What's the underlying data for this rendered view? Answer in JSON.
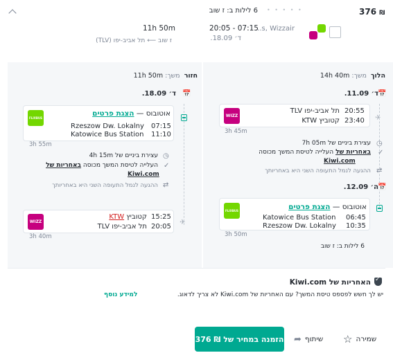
{
  "header": {
    "price": "376",
    "currency_symbol": "₪",
    "nights": "6 לילות ב: ז שוב",
    "carriers_text": "...s, Wizzair",
    "outbound_time": "20:05 - 07:15",
    "outbound_duration": "11h 50m",
    "outbound_date": "ד׳ 18.09.",
    "route_to": "ז שוב",
    "route_from": "תל אביב-יפו (TLV)"
  },
  "outbound": {
    "direction_label": "הלוך",
    "duration_label": "משך:",
    "duration": "14h 40m",
    "date": "ד׳ 11.09.",
    "flight": {
      "dep_time": "20:55",
      "dep_place": "תל אביב-יפו TLV",
      "arr_time": "23:40",
      "arr_place": "קטוביץ KTW",
      "duration": "3h 45m",
      "logo_text": "WIZZ"
    },
    "layover": {
      "title": "עצירת ביניים של 7h 05m",
      "self_transfer": "העלייה לטיסת המשך מכוסה",
      "guarantee_link": "באחריות של",
      "kiwi": "Kiwi.com",
      "terminal_note": "ההגעה לנמל התעופה השני היא באחריותך"
    },
    "date2": "ה׳ 12.09.",
    "bus": {
      "title_link": "הצגת פרטים",
      "title_prefix": "אוטובוס —",
      "dep_time": "06:45",
      "dep_place": "Katowice Bus Station",
      "arr_time": "10:35",
      "arr_place": "Rzeszow Dw. Lokalny",
      "duration": "3h 50m",
      "logo_text": "FLIXBUS"
    },
    "nights_note": "6 לילות ב: ז שוב"
  },
  "return": {
    "direction_label": "חזור",
    "duration_label": "משך:",
    "duration": "11h 50m",
    "date": "ד׳ 18.09.",
    "bus": {
      "title_link": "הצגת פרטים",
      "title_prefix": "אוטובוס —",
      "dep_time": "07:15",
      "dep_place": "Rzeszow Dw. Lokalny",
      "arr_time": "11:10",
      "arr_place": "Katowice Bus Station",
      "duration": "3h 55m",
      "logo_text": "FLIXBUS"
    },
    "layover": {
      "title": "עצירת ביניים של 4h 15m",
      "self_transfer": "העלייה לטיסת המשך מכוסה",
      "guarantee_link": "באחריות של",
      "kiwi": "Kiwi.com",
      "terminal_note": "ההגעה לנמל התעופה השני היא באחריותך"
    },
    "flight": {
      "dep_time": "15:25",
      "dep_place_prefix": "קטוביץ",
      "dep_code": "KTW",
      "arr_time": "20:05",
      "arr_place": "תל אביב-יפו TLV",
      "duration": "3h 40m",
      "logo_text": "WIZZ"
    }
  },
  "guarantee": {
    "title": "האחריות של Kiwi.com",
    "body": "יש לך חשש לפספס טיסת המשך? עם האחריות של Kiwi.com לא צריך לדאוג.",
    "more_link": "למידע נוסף"
  },
  "footer": {
    "save_label": "שמירה",
    "share_label": "שיתוף",
    "book_label": "הזמנה במחיר של",
    "book_price": "₪ 376"
  },
  "colors": {
    "accent": "#00a991",
    "flixbus": "#73d700",
    "wizzair": "#c6007e"
  }
}
